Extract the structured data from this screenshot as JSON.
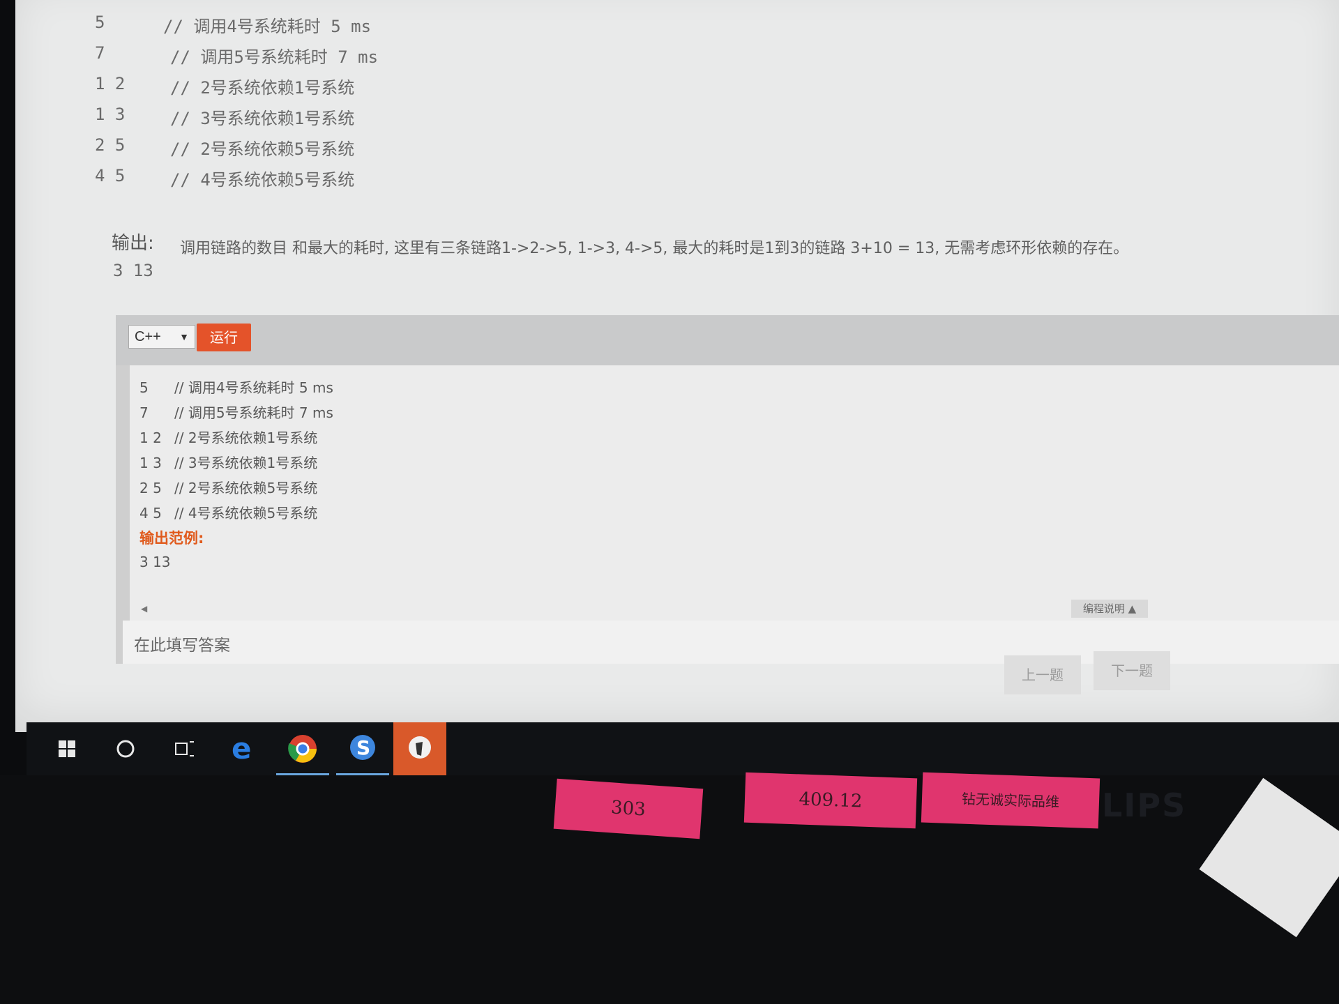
{
  "problem": {
    "input_lines": [
      {
        "num": "5",
        "comment": "// 调用4号系统耗时 5 ms"
      },
      {
        "num": "7",
        "comment": "//  调用5号系统耗时 7 ms"
      },
      {
        "num": "1 2",
        "comment": "//  2号系统依赖1号系统"
      },
      {
        "num": "1 3",
        "comment": "//  3号系统依赖1号系统"
      },
      {
        "num": "2 5",
        "comment": "//  2号系统依赖5号系统"
      },
      {
        "num": "4 5",
        "comment": "//  4号系统依赖5号系统"
      }
    ],
    "output_label": "输出:",
    "output_desc": "调用链路的数目 和最大的耗时, 这里有三条链路1->2->5, 1->3, 4->5, 最大的耗时是1到3的链路 3+10 = 13, 无需考虑环形依赖的存在。",
    "output_value": "3  13"
  },
  "editor": {
    "language": "C++",
    "run_label": "运行",
    "example_lines": [
      {
        "num": "5",
        "comment": "// 调用4号系统耗时 5 ms"
      },
      {
        "num": "7",
        "comment": "// 调用5号系统耗时 7 ms"
      },
      {
        "num": "1 2",
        "comment": "// 2号系统依赖1号系统"
      },
      {
        "num": "1 3",
        "comment": "// 3号系统依赖1号系统"
      },
      {
        "num": "2 5",
        "comment": "// 2号系统依赖5号系统"
      },
      {
        "num": "4 5",
        "comment": "// 4号系统依赖5号系统"
      }
    ],
    "output_title": "输出范例:",
    "output_value": "3 13",
    "help_label": "编程说明 ▲",
    "answer_placeholder": "在此填写答案"
  },
  "navigation": {
    "prev_label": "上一题",
    "next_label": "下一题"
  },
  "taskbar": {
    "items": [
      "windows-icon",
      "cortana-icon",
      "task-view-icon",
      "edge-icon",
      "chrome-icon",
      "sogou-icon",
      "app-icon"
    ],
    "accent": "#d9592a"
  },
  "sticky_notes": [
    "303",
    "409.12",
    "钻无诚实际品维"
  ],
  "monitor_brand": "LIPS"
}
